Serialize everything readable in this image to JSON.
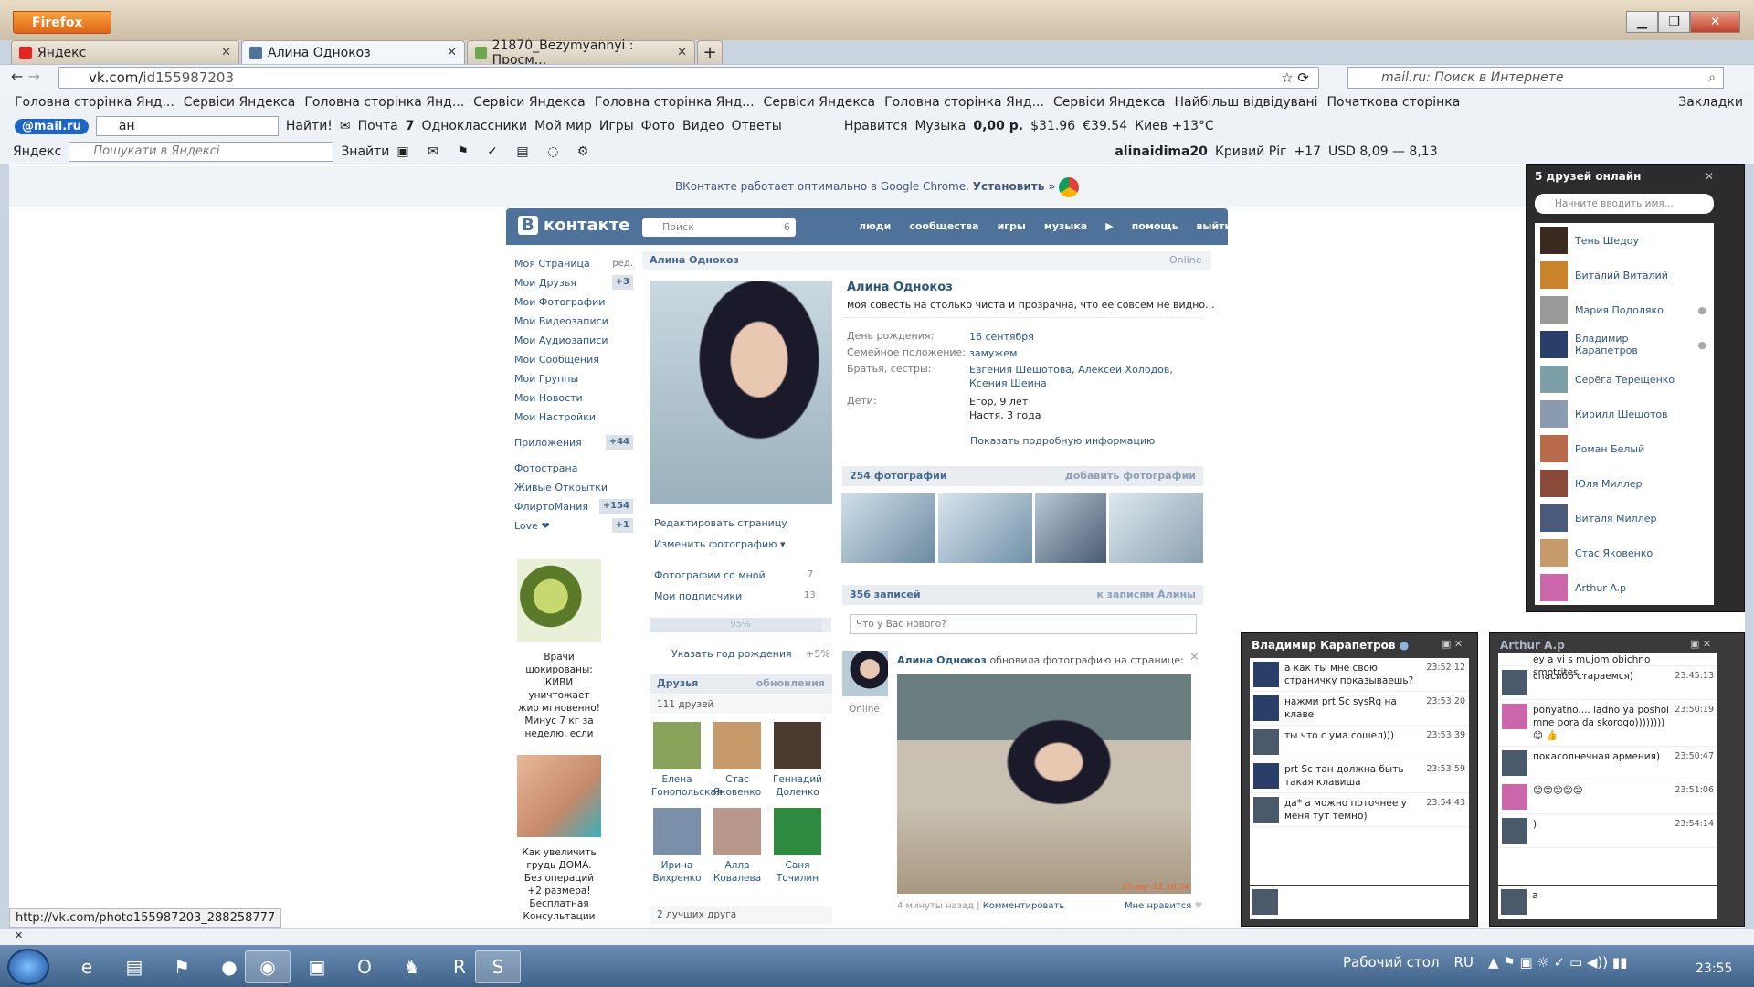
{
  "browser": {
    "menu_label": "Firefox",
    "tabs": [
      {
        "title": "Яндекс",
        "favicon_color": "#e52620"
      },
      {
        "title": "Алина Однокоз",
        "favicon_color": "#4e729a"
      },
      {
        "title": "21870_Bezymyannyi : Просм...",
        "favicon_color": "#6fa84c"
      }
    ],
    "url_host": "vk.com/",
    "url_path": "id155987203",
    "search_placeholder": "mail.ru: Поиск в Интернете",
    "bookmarks": [
      "Головна сторінка Янд...",
      "Сервіси Яндекса",
      "Головна сторінка Янд...",
      "Сервіси Яндекса",
      "Головна сторінка Янд...",
      "Сервіси Яндекса",
      "Головна сторінка Янд...",
      "Сервіси Яндекса",
      "Найбільш відвідувані",
      "Початкова сторінка"
    ],
    "bookmarks_menu": "Закладки",
    "mailru": {
      "logo": "@mail.ru",
      "input_value": "ан",
      "find_label": "Найти!",
      "links": [
        "Почта",
        "Одноклассники",
        "Мой мир",
        "Игры",
        "Фото",
        "Видео",
        "Ответы"
      ],
      "mail_count": "7",
      "like": "Нравится",
      "music": "Музыка",
      "balance": "0,00 р.",
      "usd": "31.96",
      "eur": "39.54",
      "weather": "Киев +13°С"
    },
    "yandex": {
      "logo": "Яндекс",
      "placeholder": "Пошукати в Яндексі",
      "find_label": "Знайти",
      "user": "alinaidima20",
      "city": "Кривий Ріг",
      "temp": "+17",
      "rate": "USD 8,09 — 8,13"
    },
    "status_url": "http://vk.com/photo155987203_288258777"
  },
  "vk": {
    "chrome_notice": "ВКонтакте работает оптимально в Google Chrome.",
    "chrome_install": "Установить »",
    "logo": "контакте",
    "search_placeholder": "Поиск",
    "search_count": "6",
    "nav": [
      "люди",
      "сообщества",
      "игры",
      "музыка",
      "помощь",
      "выйти"
    ],
    "menu": [
      {
        "label": "Моя Страница",
        "badge": "ред."
      },
      {
        "label": "Мои Друзья",
        "badge": "+3"
      },
      {
        "label": "Мои Фотографии",
        "badge": ""
      },
      {
        "label": "Мои Видеозаписи",
        "badge": ""
      },
      {
        "label": "Мои Аудиозаписи",
        "badge": ""
      },
      {
        "label": "Мои Сообщения",
        "badge": ""
      },
      {
        "label": "Мои Группы",
        "badge": ""
      },
      {
        "label": "Мои Новости",
        "badge": ""
      },
      {
        "label": "Мои Настройки",
        "badge": ""
      },
      {
        "label": "Приложения",
        "badge": "+44"
      },
      {
        "label": "Фотострана",
        "badge": ""
      },
      {
        "label": "Живые Открытки",
        "badge": ""
      },
      {
        "label": "ФлиртоМания",
        "badge": "+154"
      },
      {
        "label": "Love ❤",
        "badge": "+1"
      }
    ],
    "ad1": "Врачи шокированы: КИВИ уничтожает жир мгновенно! Минус 7 кг за неделю, если",
    "ad2": "Как увеличить грудь ДОМА. Без операций +2 размера! Бесплатная Консультации",
    "profile": {
      "header": "Алина Однокоз",
      "online": "Online",
      "name": "Алина Однокоз",
      "status": "моя совесть на столько чиста и прозрачна, что ее совсем не видно...",
      "birthday_label": "День рождения:",
      "birthday": "16 сентября",
      "family_label": "Семейное положение:",
      "family": "замужем",
      "siblings_label": "Братья, сестры:",
      "siblings": "Евгения Шешотова, Алексей Холодов, Ксения Шеина",
      "kids_label": "Дети:",
      "kids1": "Егор, 9 лет",
      "kids2": "Настя, 3 года",
      "more_info": "Показать подробную информацию",
      "edit": "Редактировать страницу",
      "change_photo": "Изменить фотографию",
      "photos_with_me": "Фотографии со мной",
      "photos_with_me_count": "7",
      "subscribers": "Мои подписчики",
      "subscribers_count": "13",
      "progress": "95%",
      "progress_value": 0.95,
      "year_hint": "Указать год рождения",
      "year_bonus": "+5%",
      "photos_count": "254 фотографии",
      "add_photos": "добавить фотографии",
      "records": "356 записей",
      "to_records": "к записям Алины",
      "wall_placeholder": "Что у Вас нового?",
      "post_author": "Алина Однокоз",
      "post_action": "обновила фотографию на странице:",
      "post_online": "Online",
      "post_time": "4 минуты назад",
      "post_comment": "Комментировать",
      "post_like": "Мне нравится",
      "photo_stamp": "20-авг-12 10:34"
    },
    "friends": {
      "header": "Друзья",
      "updates": "обновления",
      "count": "111 друзей",
      "best": "2 лучших друга",
      "list": [
        {
          "name": "Елена Гонопольская",
          "color": "#8aa35a"
        },
        {
          "name": "Стас Яковенко",
          "color": "#c79a6a"
        },
        {
          "name": "Геннадий Доленко",
          "color": "#4a3a30"
        },
        {
          "name": "Ирина Вихренко",
          "color": "#7a8fa8"
        },
        {
          "name": "Алла Ковалева",
          "color": "#b8988a"
        },
        {
          "name": "Саня Точилин",
          "color": "#2e8a3e"
        }
      ]
    },
    "online": {
      "header": "5 друзей онлайн",
      "placeholder": "Начните вводить имя...",
      "list": [
        {
          "name": "Тень Шедоу",
          "color": "#3a2a20",
          "dot": false
        },
        {
          "name": "Виталий Виталий",
          "color": "#c9832a",
          "dot": false
        },
        {
          "name": "Мария Подоляко",
          "color": "#999999",
          "dot": true
        },
        {
          "name": "Владимир Карапетров",
          "color": "#2a3e6a",
          "dot": true
        },
        {
          "name": "Серёга Терещенко",
          "color": "#7ba0a8",
          "dot": false
        },
        {
          "name": "Кирилл Шешотов",
          "color": "#8a9ab0",
          "dot": false
        },
        {
          "name": "Роман Белый",
          "color": "#b86a4a",
          "dot": false
        },
        {
          "name": "Юля Миллер",
          "color": "#8a4a3a",
          "dot": false
        },
        {
          "name": "Виталя Миллер",
          "color": "#4a5a7a",
          "dot": false
        },
        {
          "name": "Стас Яковенко",
          "color": "#c79a6a",
          "dot": false
        },
        {
          "name": "Arthur A.p",
          "color": "#cc66aa",
          "dot": false
        }
      ]
    },
    "chat1": {
      "title": "Владимир Карапетров",
      "messages": [
        {
          "text": "а как ты мне свою страничку показываешь?",
          "time": "23:52:12"
        },
        {
          "text": "нажми prt Sc sysRq на клаве",
          "time": "23:53:20"
        },
        {
          "text": "ты что с ума сошел)))",
          "time": "23:53:39"
        },
        {
          "text": "prt Sc тан должна быть такая клавиша",
          "time": "23:53:59"
        },
        {
          "text": "да* а можно поточнее у меня тут темно)",
          "time": "23:54:43"
        }
      ]
    },
    "chat2": {
      "title": "Arthur A.p",
      "top_text": "ey a vi s mujom obichno smotrites...",
      "messages": [
        {
          "text": "спасибо стараемся)",
          "time": "23:45:13"
        },
        {
          "text": "ponyatno.... ladno ya poshol mne pora da skorogo)))))))) 😊 👍",
          "time": "23:50:19"
        },
        {
          "text": "покасолнечная армения)",
          "time": "23:50:47"
        },
        {
          "text": "😊😊😊😊😊",
          "time": "23:51:06"
        },
        {
          "text": ")",
          "time": "23:54:14"
        }
      ],
      "input": "a"
    }
  },
  "taskbar": {
    "desktop": "Рабочий стол",
    "lang": "RU",
    "clock": "23:55"
  }
}
